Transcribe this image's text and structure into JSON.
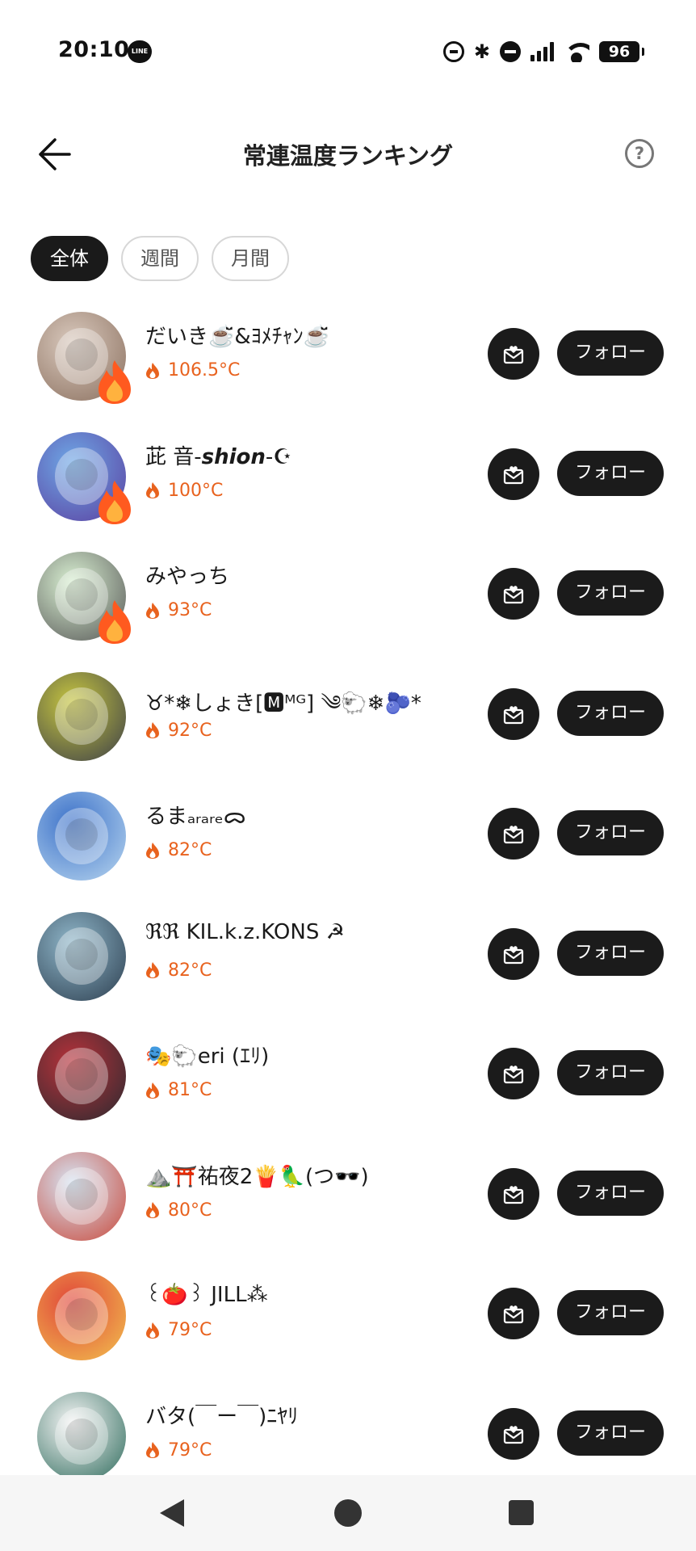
{
  "status_bar": {
    "time": "20:10",
    "line_badge": "LINE",
    "battery": "96"
  },
  "header": {
    "title": "常連温度ランキング",
    "help_icon": "?"
  },
  "tabs": [
    {
      "label": "全体",
      "active": true
    },
    {
      "label": "週間",
      "active": false
    },
    {
      "label": "月間",
      "active": false
    }
  ],
  "ranking": [
    {
      "name": "だいき☕️̆̈&ﾖﾒﾁｬﾝ☕️̆̈",
      "temperature": "106.5°C",
      "fire_badge": true,
      "avatar_colors": [
        "#d9c9bd",
        "#8a6f5e"
      ],
      "follow_label": "フォロー"
    },
    {
      "name": "茈 音-𝙨𝙝𝙞𝙤𝙣-☪︎",
      "temperature": "100°C",
      "fire_badge": true,
      "avatar_colors": [
        "#6ea8e6",
        "#5b3fa0"
      ],
      "follow_label": "フォロー"
    },
    {
      "name": "みやっち",
      "temperature": "93°C",
      "fire_badge": true,
      "avatar_colors": [
        "#d9f0d2",
        "#555555"
      ],
      "follow_label": "フォロー"
    },
    {
      "name": "♉︎*❄︎しょき[🅼ᴹᴳ] ༄🐑❄︎🫐*",
      "temperature": "92°C",
      "fire_badge": false,
      "avatar_colors": [
        "#c7c640",
        "#3b3e48"
      ],
      "follow_label": "フォロー"
    },
    {
      "name": "るまₐᵣₐᵣₑᯅ",
      "temperature": "82°C",
      "fire_badge": false,
      "avatar_colors": [
        "#3d72c9",
        "#b8d6ef"
      ],
      "follow_label": "フォロー"
    },
    {
      "name": "ℜℜ KIL.k.z.KONS ☭",
      "temperature": "82°C",
      "fire_badge": false,
      "avatar_colors": [
        "#8fb6c9",
        "#2c3e4f"
      ],
      "follow_label": "フォロー"
    },
    {
      "name": "🎭🐑eri (ｴﾘ)",
      "temperature": "81°C",
      "fire_badge": false,
      "avatar_colors": [
        "#b8323a",
        "#2a2a30"
      ],
      "follow_label": "フォロー"
    },
    {
      "name": "⛰️⛩️祐夜2🍟🦜(つ🕶️)",
      "temperature": "80°C",
      "fire_badge": false,
      "avatar_colors": [
        "#d6e3f2",
        "#c94a3c"
      ],
      "follow_label": "フォロー"
    },
    {
      "name": "꒰🍅꒱ JILL⁂",
      "temperature": "79°C",
      "fire_badge": false,
      "avatar_colors": [
        "#e0463a",
        "#f2c14e"
      ],
      "follow_label": "フォロー"
    },
    {
      "name": "バタ(￣ー￣)ﾆﾔﾘ",
      "temperature": "79°C",
      "fire_badge": false,
      "avatar_colors": [
        "#f4f4f4",
        "#2e6b5c"
      ],
      "follow_label": "フォロー"
    }
  ],
  "colors": {
    "accent_temperature": "#e8621e",
    "fire_badge": "#ff5a1f",
    "button_bg": "#1b1b1b"
  }
}
